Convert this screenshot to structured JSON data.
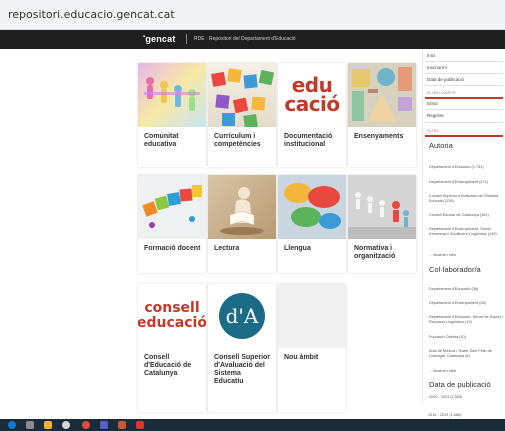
{
  "browser": {
    "url": "repositori.educacio.gencat.cat"
  },
  "header": {
    "logo": "gencat",
    "subtitle": "RDE · Repositori del Departament d'Educació"
  },
  "cards": [
    {
      "label": "Comunitat educativa",
      "image": "paper-people-image"
    },
    {
      "label": "Currículum i competències",
      "image": "alphabet-blocks-image"
    },
    {
      "label": "Documentació institucional",
      "image": "edu-cacio-logo",
      "logo_text": [
        "edu",
        "cació"
      ]
    },
    {
      "label": "Ensenyaments",
      "image": "wooden-shapes-image"
    },
    {
      "label": "Formació docent",
      "image": "puzzle-people-image"
    },
    {
      "label": "Lectura",
      "image": "reading-figure-image"
    },
    {
      "label": "Llengua",
      "image": "speech-bubbles-image"
    },
    {
      "label": "Normativa i organització",
      "image": "figures-image"
    },
    {
      "label": "Consell d'Educació de Catalunya",
      "image": "consell-educacio-logo",
      "logo_text": [
        "consell",
        "educació"
      ]
    },
    {
      "label": "Consell Superior d'Avaluació del Sistema Educatiu",
      "image": "csa-logo",
      "logo_text": "d'A"
    },
    {
      "label": "Nou àmbit",
      "image": "blank-image"
    }
  ],
  "sidebar": {
    "top_items": [
      "Inici",
      "Inscriure's",
      "Data de publicació"
    ],
    "caption_1": "EL MEU COMPTE",
    "account_items": [
      "Entra",
      "Registre"
    ],
    "caption_2": "FILTRA",
    "autoria_title": "Autoria",
    "autoria_items": [
      "Departament d'Educació (1.741)",
      "Departament d'Ensenyament (471)",
      "Consell Superior d'Avaluació del Sistema Educatiu (226)",
      "Consell Escolar de Catalunya (161)",
      "Departament d'Ensenyament. Servei d'Immersió i Acolliment Lingüístics (149)",
      "... Mostra'n més"
    ],
    "col_title": "Col·laborador/a",
    "col_items": [
      "Departament d'Educació (36)",
      "Departament d'Ensenyament (28)",
      "Departament d'Educació. Servei de Suport i Recursos Lingüístics (19)",
      "Fundació Orienta (10)",
      "Aula de Música i Teatre Sant Feliu de Llobregat. Catalunya (8)",
      "... Mostra'n més"
    ],
    "date_title": "Data de publicació",
    "date_items": [
      "2020 - 2024 (2.583)",
      "2015 - 2019 (1.666)"
    ]
  },
  "colors": {
    "accent": "#c0392b",
    "header_bg": "#1f1f1f",
    "taskbar_bg": "#1c2b3a"
  }
}
